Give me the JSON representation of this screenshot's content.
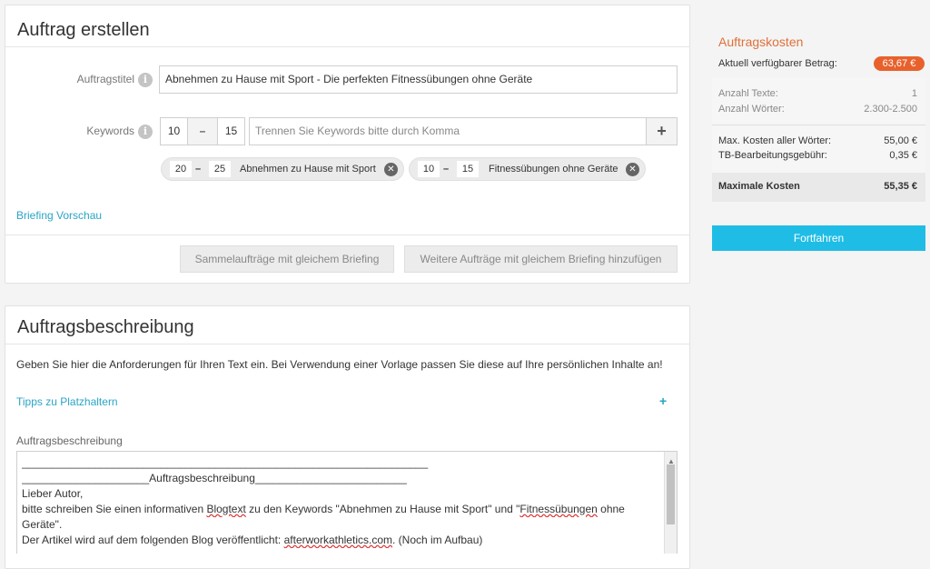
{
  "order": {
    "title": "Auftrag erstellen",
    "title_label": "Auftragstitel",
    "title_value": "Abnehmen zu Hause mit Sport - Die perfekten Fitnessübungen ohne Geräte",
    "keywords_label": "Keywords",
    "kw_min": "10",
    "kw_dash": "–",
    "kw_max": "15",
    "kw_placeholder": "Trennen Sie Keywords bitte durch Komma",
    "kw_add": "+",
    "tags": [
      {
        "min": "20",
        "max": "25",
        "label": "Abnehmen zu Hause mit Sport"
      },
      {
        "min": "10",
        "max": "15",
        "label": "Fitnessübungen ohne Geräte"
      }
    ],
    "briefing_preview": "Briefing Vorschau",
    "btn_bulk": "Sammelaufträge mit gleichem Briefing",
    "btn_more": "Weitere Aufträge mit gleichem Briefing hinzufügen"
  },
  "description": {
    "title": "Auftragsbeschreibung",
    "intro": "Geben Sie hier die Anforderungen für Ihren Text ein. Bei Verwendung einer Vorlage passen Sie diese auf Ihre persönlichen Inhalte an!",
    "tips_link": "Tipps zu Platzhaltern",
    "tips_expand": "+",
    "field_label": "Auftragsbeschreibung",
    "line1": "___________________________________________________________________",
    "line2_pre": "_____________________",
    "line2_mid": "Auftragsbeschreibung",
    "line2_post": "_________________________",
    "line3": "Lieber Autor,",
    "line4_a": "bitte schreiben Sie einen informativen ",
    "line4_b": "Blogtext",
    "line4_c": " zu den Keywords \"Abnehmen zu Hause mit Sport\" und \"",
    "line4_d": "Fitnessübungen",
    "line4_e": " ohne",
    "line5": "Geräte\".",
    "line6_a": "Der Artikel wird auf dem folgenden Blog veröffentlicht: ",
    "line6_b": "afterworkathletics.com",
    "line6_c": ". (Noch im Aufbau)"
  },
  "costs": {
    "title": "Auftragskosten",
    "available_label": "Aktuell verfügbarer Betrag:",
    "available_value": "63,67 €",
    "texts_label": "Anzahl Texte:",
    "texts_value": "1",
    "words_label": "Anzahl Wörter:",
    "words_value": "2.300-2.500",
    "max_words_label": "Max. Kosten aller Wörter:",
    "max_words_value": "55,00 €",
    "fee_label": "TB-Bearbeitungsgebühr:",
    "fee_value": "0,35 €",
    "total_label": "Maximale Kosten",
    "total_value": "55,35 €",
    "continue": "Fortfahren"
  },
  "colors": {
    "accent": "#1fbde6",
    "orange": "#e8612c",
    "link": "#2aa5c6"
  }
}
